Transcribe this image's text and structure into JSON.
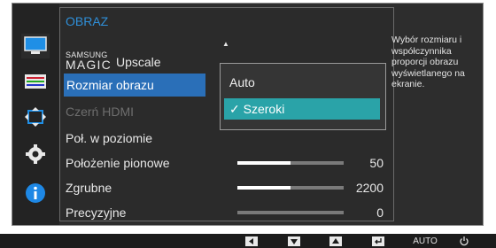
{
  "menu": {
    "title": "OBRAZ",
    "magic_upscale": {
      "brand_small": "SAMSUNG",
      "brand_big": "MAGIC",
      "label": "Upscale"
    },
    "items": [
      {
        "label": "Rozmiar obrazu"
      },
      {
        "label": "Czerń HDMI"
      },
      {
        "label": "Poł. w poziomie"
      },
      {
        "label": "Położenie pionowe",
        "value": "50",
        "level": 0.5
      },
      {
        "label": "Zgrubne",
        "value": "2200",
        "level": 0.5
      },
      {
        "label": "Precyzyjne",
        "value": "0",
        "level": 0
      }
    ]
  },
  "popup": {
    "options": [
      {
        "label": "Auto"
      },
      {
        "label": "Szeroki",
        "checkmark": "✓"
      }
    ]
  },
  "help_text": "Wybór rozmiaru i współczynnika proporcji obrazu wyświetlanego na ekranie.",
  "left_icons": [
    "monitor-icon",
    "color-bars-icon",
    "resize-arrows-icon",
    "gear-icon",
    "info-icon"
  ],
  "bottom_buttons": {
    "auto_label": "AUTO"
  },
  "colors": {
    "selected_row": "#2a6fb8",
    "selected_option": "#2aa3a8",
    "title": "#2f8fd8",
    "info_blue": "#1e88e5"
  }
}
